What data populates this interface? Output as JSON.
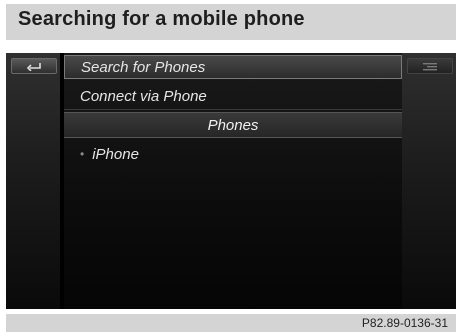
{
  "header": {
    "title": "Searching for a mobile phone"
  },
  "screen": {
    "left_button": {
      "icon": "back-arrow-icon"
    },
    "right_button": {
      "icon": "list-menu-icon"
    },
    "menu": {
      "items": [
        {
          "label": "Search for Phones",
          "selected": true
        },
        {
          "label": "Connect via Phone",
          "selected": false
        }
      ],
      "section_header": "Phones",
      "phones": [
        {
          "bullet": "•",
          "label": "iPhone"
        }
      ]
    }
  },
  "caption": {
    "code": "P82.89-0136-31"
  }
}
